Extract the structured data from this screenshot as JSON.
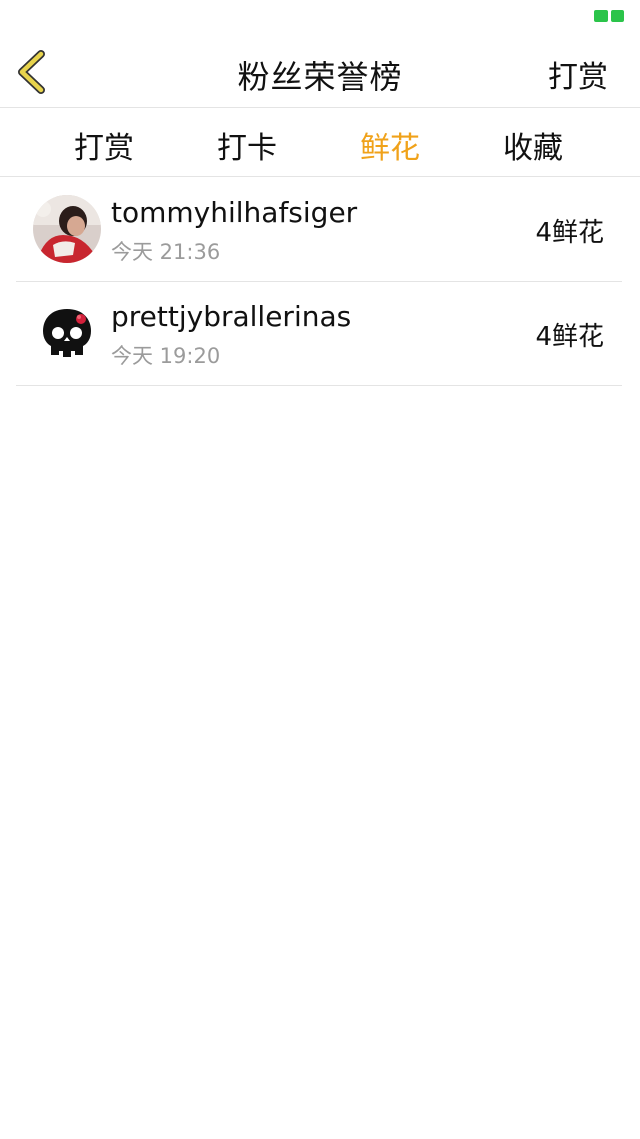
{
  "header": {
    "title": "粉丝荣誉榜",
    "action_label": "打赏"
  },
  "tabs": [
    {
      "label": "打赏",
      "active": false
    },
    {
      "label": "打卡",
      "active": false
    },
    {
      "label": "鲜花",
      "active": true
    },
    {
      "label": "收藏",
      "active": false
    }
  ],
  "list": [
    {
      "username": "tommyhilhafsiger",
      "time": "今天 21:36",
      "amount": "4鲜花",
      "avatar": "photo-avatar"
    },
    {
      "username": "prettjybrallerinas",
      "time": "今天 19:20",
      "amount": "4鲜花",
      "avatar": "skull-avatar"
    }
  ],
  "colors": {
    "accent": "#f0a21a",
    "back_icon": "#e8d44d",
    "status_indicator": "#2bc44a",
    "divider": "#e4e4e4",
    "secondary_text": "#9b9b9b"
  }
}
